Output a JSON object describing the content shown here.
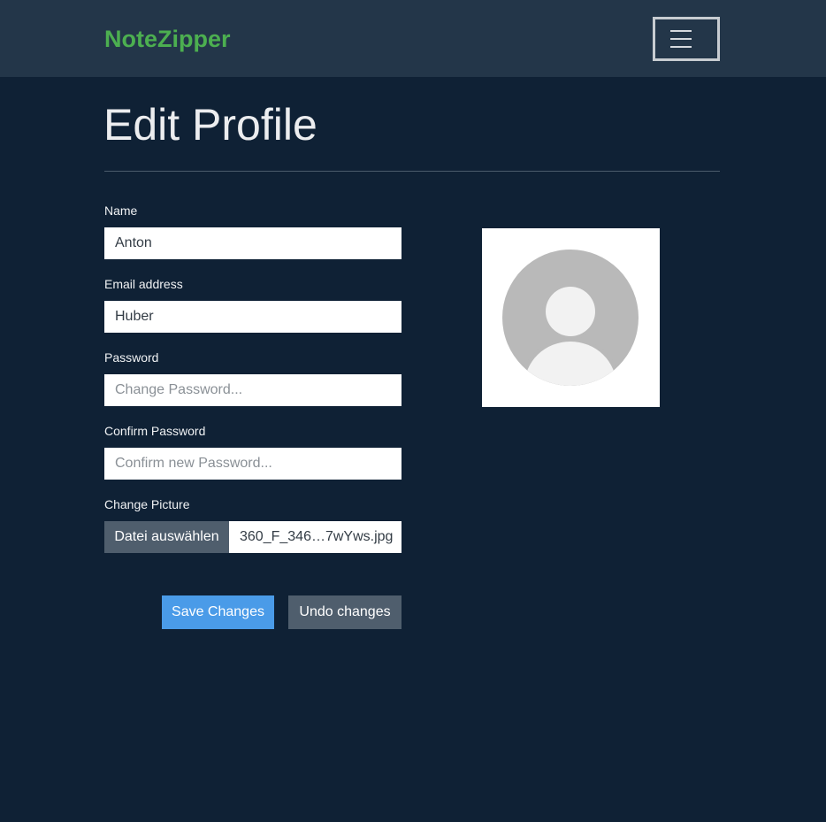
{
  "navbar": {
    "brand": "NoteZipper",
    "brand_color": "#4caf50",
    "menu_icon": "hamburger-menu-icon"
  },
  "page": {
    "title": "Edit Profile"
  },
  "form": {
    "name": {
      "label": "Name",
      "value": "Anton"
    },
    "email": {
      "label": "Email address",
      "value": "Huber"
    },
    "password": {
      "label": "Password",
      "placeholder": "Change Password..."
    },
    "confirm_password": {
      "label": "Confirm Password",
      "placeholder": "Confirm new Password..."
    },
    "picture": {
      "label": "Change Picture",
      "button_label": "Datei auswählen",
      "file_name": "360_F_346…7wYws.jpg"
    }
  },
  "actions": {
    "save_label": "Save Changes",
    "undo_label": "Undo changes",
    "save_color": "#4a9be8"
  },
  "avatar": {
    "icon": "default-user-avatar-icon"
  }
}
